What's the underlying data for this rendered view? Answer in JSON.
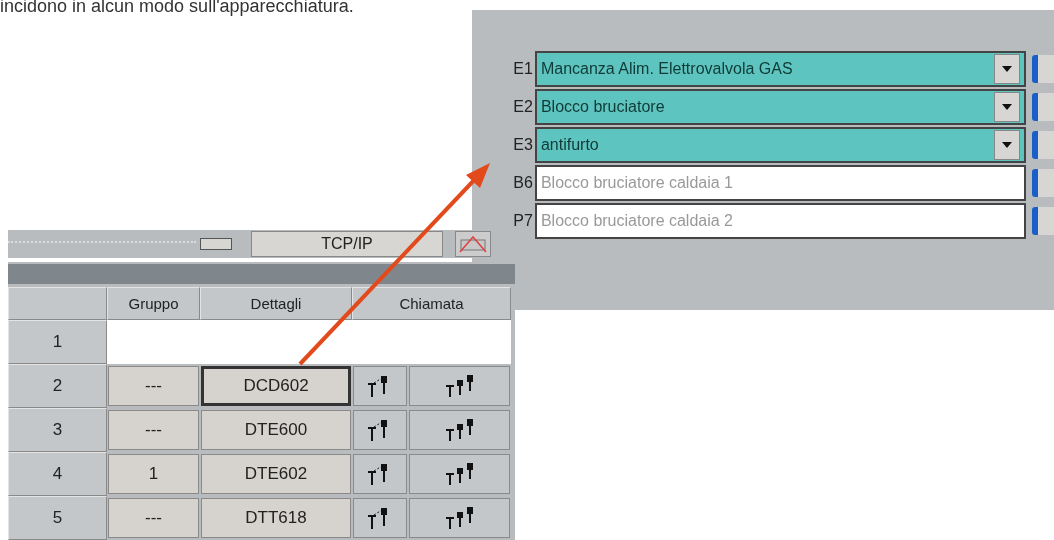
{
  "intro_text": "incidono in alcun modo sull'apparecchiatura.",
  "event_panel": {
    "events": [
      {
        "code": "E1",
        "description": "Mancanza Alim. Elettrovalvola GAS",
        "kind": "dropdown"
      },
      {
        "code": "E2",
        "description": "Blocco bruciatore",
        "kind": "dropdown"
      },
      {
        "code": "E3",
        "description": "antifurto",
        "kind": "dropdown"
      },
      {
        "code": "B6",
        "description": "Blocco bruciatore caldaia 1",
        "kind": "text"
      },
      {
        "code": "P7",
        "description": "Blocco bruciatore caldaia 2",
        "kind": "text"
      }
    ]
  },
  "device_window": {
    "protocol_button": "TCP/IP",
    "table": {
      "columns": [
        "Gruppo",
        "Dettagli",
        "Chiamata"
      ],
      "rows": [
        {
          "number": "1"
        },
        {
          "number": "2",
          "gruppo": "---",
          "dettagli": "DCD602",
          "selected": true
        },
        {
          "number": "3",
          "gruppo": "---",
          "dettagli": "DTE600",
          "selected": false
        },
        {
          "number": "4",
          "gruppo": "1",
          "dettagli": "DTE602",
          "selected": false
        },
        {
          "number": "5",
          "gruppo": "---",
          "dettagli": "DTT618",
          "selected": false
        }
      ]
    }
  }
}
